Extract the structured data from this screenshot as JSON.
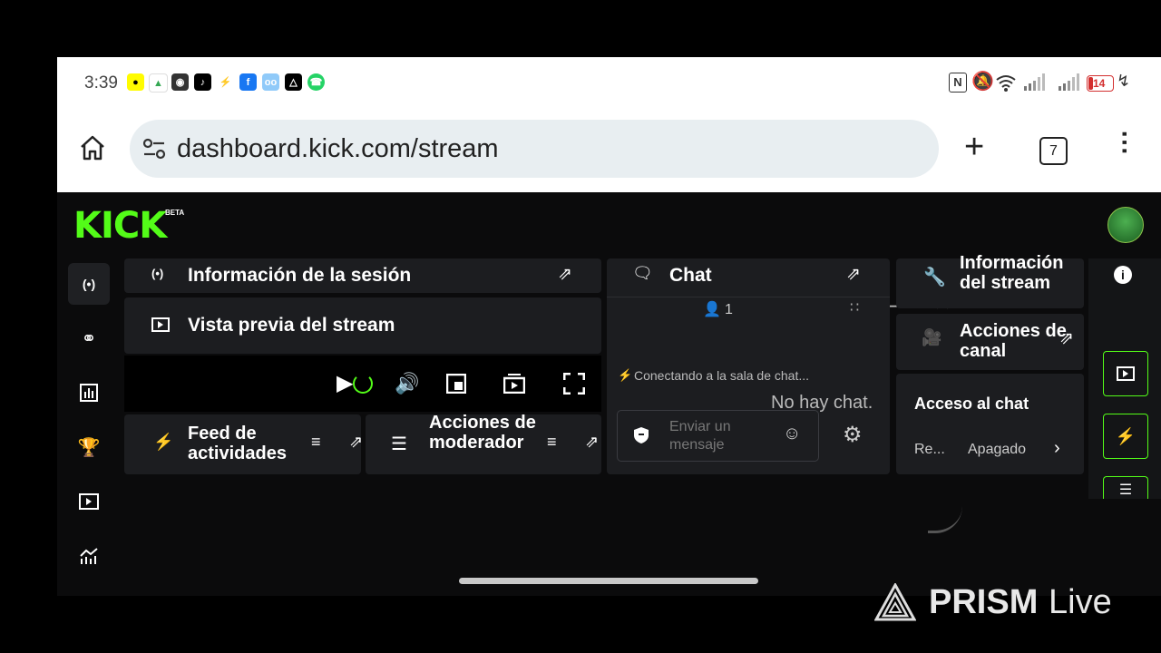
{
  "statusbar": {
    "time": "3:39",
    "battery": "14"
  },
  "browser": {
    "url": "dashboard.kick.com/stream",
    "tab_count": "7"
  },
  "kick": {
    "logo": "KICK",
    "beta": "BETA",
    "panels": {
      "session_info": "Información de la sesión",
      "stream_preview": "Vista previa del stream",
      "activity_feed": "Feed de actividades",
      "mod_actions": "Acciones de moderador",
      "chat": "Chat",
      "viewer_count": "1",
      "connecting": "Conectando a la sala de chat...",
      "no_chat": "No hay chat.",
      "send_placeholder": "Enviar un mensaje",
      "stream_info": "Información del stream",
      "channel_actions": "Acciones de canal",
      "chat_access": "Acceso al chat",
      "access_label": "Re...",
      "access_value": "Apagado"
    }
  },
  "watermark": {
    "prism": "PRISM",
    "live": "Live"
  },
  "colors": {
    "accent": "#53fc18",
    "panel": "#1c1d20",
    "background": "#0b0b0c"
  }
}
